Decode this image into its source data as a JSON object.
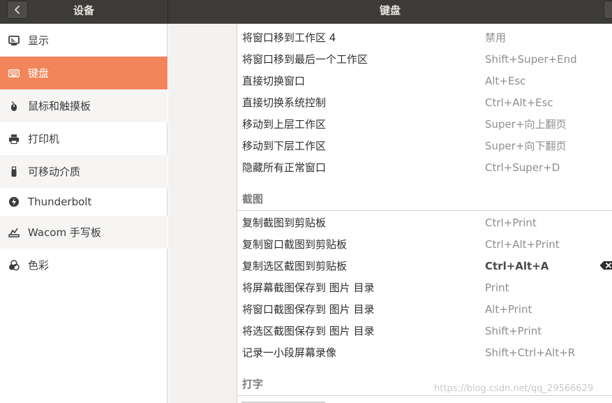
{
  "header": {
    "left_title": "设备",
    "right_title": "键盘",
    "back_icon": "chevron-left-icon"
  },
  "sidebar": {
    "items": [
      {
        "label": "显示",
        "icon": "display-icon"
      },
      {
        "label": "键盘",
        "icon": "keyboard-icon",
        "active": true
      },
      {
        "label": "鼠标和触摸板",
        "icon": "mouse-icon"
      },
      {
        "label": "打印机",
        "icon": "printer-icon"
      },
      {
        "label": "可移动介质",
        "icon": "usb-icon"
      },
      {
        "label": "Thunderbolt",
        "icon": "thunderbolt-icon"
      },
      {
        "label": "Wacom 手写板",
        "icon": "tablet-icon"
      },
      {
        "label": "色彩",
        "icon": "color-icon"
      }
    ],
    "active_color": "#f2855a"
  },
  "shortcuts": {
    "navigation_rows": [
      {
        "label": "将窗口移到工作区 4",
        "key": "禁用"
      },
      {
        "label": "将窗口移到最后一个工作区",
        "key": "Shift+Super+End"
      },
      {
        "label": "直接切换窗口",
        "key": "Alt+Esc"
      },
      {
        "label": "直接切换系统控制",
        "key": "Ctrl+Alt+Esc"
      },
      {
        "label": "移动到上层工作区",
        "key": "Super+向上翻页"
      },
      {
        "label": "移动到下层工作区",
        "key": "Super+向下翻页"
      },
      {
        "label": "隐藏所有正常窗口",
        "key": "Ctrl+Super+D"
      }
    ],
    "screenshot_section": "截图",
    "screenshot_rows": [
      {
        "label": "复制截图到剪贴板",
        "key": "Ctrl+Print"
      },
      {
        "label": "复制窗口截图到剪贴板",
        "key": "Ctrl+Alt+Print"
      },
      {
        "label": "复制选区截图到剪贴板",
        "key": "Ctrl+Alt+A",
        "custom": true
      },
      {
        "label": "将屏幕截图保存到 图片 目录",
        "key": "Print"
      },
      {
        "label": "将窗口截图保存到 图片 目录",
        "key": "Alt+Print"
      },
      {
        "label": "将选区截图保存到 图片 目录",
        "key": "Shift+Print"
      },
      {
        "label": "记录一小段屏幕录像",
        "key": "Shift+Ctrl+Alt+R"
      }
    ],
    "typing_section": "打字",
    "clear_icon": "backspace-clear-icon"
  },
  "watermark": "https://blog.csdn.net/qq_29566629"
}
